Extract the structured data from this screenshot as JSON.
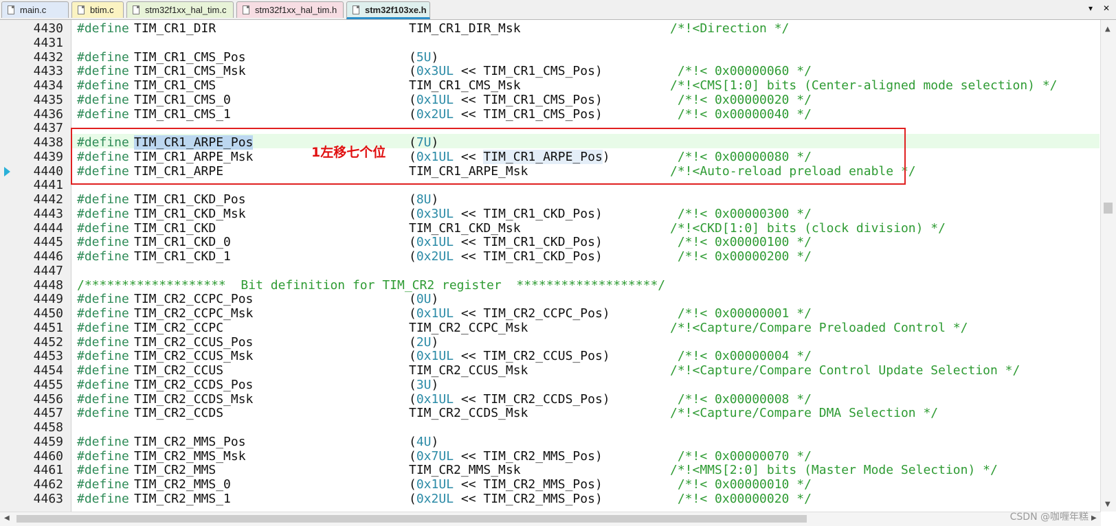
{
  "tabs": [
    {
      "label": "main.c",
      "bg": "#dfe9f7"
    },
    {
      "label": "btim.c",
      "bg": "#fbf3c2"
    },
    {
      "label": "stm32f1xx_hal_tim.c",
      "bg": "#e8f3d8"
    },
    {
      "label": "stm32f1xx_hal_tim.h",
      "bg": "#f7dde3"
    },
    {
      "label": "stm32f103xe.h",
      "bg": "#dff0ee"
    }
  ],
  "tab_controls": {
    "dropdown": "▾",
    "close": "✕"
  },
  "annotation": "1左移七个位",
  "watermark": "CSDN @咖喱年糕",
  "colors": {
    "highlight_box": "#e02020",
    "keyword": "#2e8b57",
    "comment": "#2e9b33",
    "number": "#2a8aa6"
  },
  "lines": [
    {
      "n": "4430",
      "d": "#define",
      "name": "TIM_CR1_DIR",
      "val": "TIM_CR1_DIR_Msk",
      "cmt": "/*!<Direction */"
    },
    {
      "n": "4431"
    },
    {
      "n": "4432",
      "d": "#define",
      "name": "TIM_CR1_CMS_Pos",
      "val": "(5U)"
    },
    {
      "n": "4433",
      "d": "#define",
      "name": "TIM_CR1_CMS_Msk",
      "val": "(0x3UL << TIM_CR1_CMS_Pos)",
      "cmt": " /*!< 0x00000060 */"
    },
    {
      "n": "4434",
      "d": "#define",
      "name": "TIM_CR1_CMS",
      "val": "TIM_CR1_CMS_Msk",
      "cmt": "/*!<CMS[1:0] bits (Center-aligned mode selection) */"
    },
    {
      "n": "4435",
      "d": "#define",
      "name": "TIM_CR1_CMS_0",
      "val": "(0x1UL << TIM_CR1_CMS_Pos)",
      "cmt": " /*!< 0x00000020 */"
    },
    {
      "n": "4436",
      "d": "#define",
      "name": "TIM_CR1_CMS_1",
      "val": "(0x2UL << TIM_CR1_CMS_Pos)",
      "cmt": " /*!< 0x00000040 */"
    },
    {
      "n": "4437"
    },
    {
      "n": "4438",
      "d": "#define",
      "name": "TIM_CR1_ARPE_Pos",
      "val": "(7U)"
    },
    {
      "n": "4439",
      "d": "#define",
      "name": "TIM_CR1_ARPE_Msk",
      "val": "(0x1UL << TIM_CR1_ARPE_Pos)",
      "cmt": " /*!< 0x00000080 */"
    },
    {
      "n": "4440",
      "d": "#define",
      "name": "TIM_CR1_ARPE",
      "val": "TIM_CR1_ARPE_Msk",
      "cmt": "/*!<Auto-reload preload enable */"
    },
    {
      "n": "4441"
    },
    {
      "n": "4442",
      "d": "#define",
      "name": "TIM_CR1_CKD_Pos",
      "val": "(8U)"
    },
    {
      "n": "4443",
      "d": "#define",
      "name": "TIM_CR1_CKD_Msk",
      "val": "(0x3UL << TIM_CR1_CKD_Pos)",
      "cmt": " /*!< 0x00000300 */"
    },
    {
      "n": "4444",
      "d": "#define",
      "name": "TIM_CR1_CKD",
      "val": "TIM_CR1_CKD_Msk",
      "cmt": "/*!<CKD[1:0] bits (clock division) */"
    },
    {
      "n": "4445",
      "d": "#define",
      "name": "TIM_CR1_CKD_0",
      "val": "(0x1UL << TIM_CR1_CKD_Pos)",
      "cmt": " /*!< 0x00000100 */"
    },
    {
      "n": "4446",
      "d": "#define",
      "name": "TIM_CR1_CKD_1",
      "val": "(0x2UL << TIM_CR1_CKD_Pos)",
      "cmt": " /*!< 0x00000200 */"
    },
    {
      "n": "4447"
    },
    {
      "n": "4448",
      "full": "/*******************  Bit definition for TIM_CR2 register  *******************/"
    },
    {
      "n": "4449",
      "d": "#define",
      "name": "TIM_CR2_CCPC_Pos",
      "val": "(0U)"
    },
    {
      "n": "4450",
      "d": "#define",
      "name": "TIM_CR2_CCPC_Msk",
      "val": "(0x1UL << TIM_CR2_CCPC_Pos)",
      "cmt": " /*!< 0x00000001 */"
    },
    {
      "n": "4451",
      "d": "#define",
      "name": "TIM_CR2_CCPC",
      "val": "TIM_CR2_CCPC_Msk",
      "cmt": "/*!<Capture/Compare Preloaded Control */"
    },
    {
      "n": "4452",
      "d": "#define",
      "name": "TIM_CR2_CCUS_Pos",
      "val": "(2U)"
    },
    {
      "n": "4453",
      "d": "#define",
      "name": "TIM_CR2_CCUS_Msk",
      "val": "(0x1UL << TIM_CR2_CCUS_Pos)",
      "cmt": " /*!< 0x00000004 */"
    },
    {
      "n": "4454",
      "d": "#define",
      "name": "TIM_CR2_CCUS",
      "val": "TIM_CR2_CCUS_Msk",
      "cmt": "/*!<Capture/Compare Control Update Selection */"
    },
    {
      "n": "4455",
      "d": "#define",
      "name": "TIM_CR2_CCDS_Pos",
      "val": "(3U)"
    },
    {
      "n": "4456",
      "d": "#define",
      "name": "TIM_CR2_CCDS_Msk",
      "val": "(0x1UL << TIM_CR2_CCDS_Pos)",
      "cmt": " /*!< 0x00000008 */"
    },
    {
      "n": "4457",
      "d": "#define",
      "name": "TIM_CR2_CCDS",
      "val": "TIM_CR2_CCDS_Msk",
      "cmt": "/*!<Capture/Compare DMA Selection */"
    },
    {
      "n": "4458"
    },
    {
      "n": "4459",
      "d": "#define",
      "name": "TIM_CR2_MMS_Pos",
      "val": "(4U)"
    },
    {
      "n": "4460",
      "d": "#define",
      "name": "TIM_CR2_MMS_Msk",
      "val": "(0x7UL << TIM_CR2_MMS_Pos)",
      "cmt": " /*!< 0x00000070 */"
    },
    {
      "n": "4461",
      "d": "#define",
      "name": "TIM_CR2_MMS",
      "val": "TIM_CR2_MMS_Msk",
      "cmt": "/*!<MMS[2:0] bits (Master Mode Selection) */"
    },
    {
      "n": "4462",
      "d": "#define",
      "name": "TIM_CR2_MMS_0",
      "val": "(0x1UL << TIM_CR2_MMS_Pos)",
      "cmt": " /*!< 0x00000010 */"
    },
    {
      "n": "4463",
      "d": "#define",
      "name": "TIM_CR2_MMS_1",
      "val": "(0x2UL << TIM_CR2_MMS_Pos)",
      "cmt": " /*!< 0x00000020 */"
    }
  ]
}
